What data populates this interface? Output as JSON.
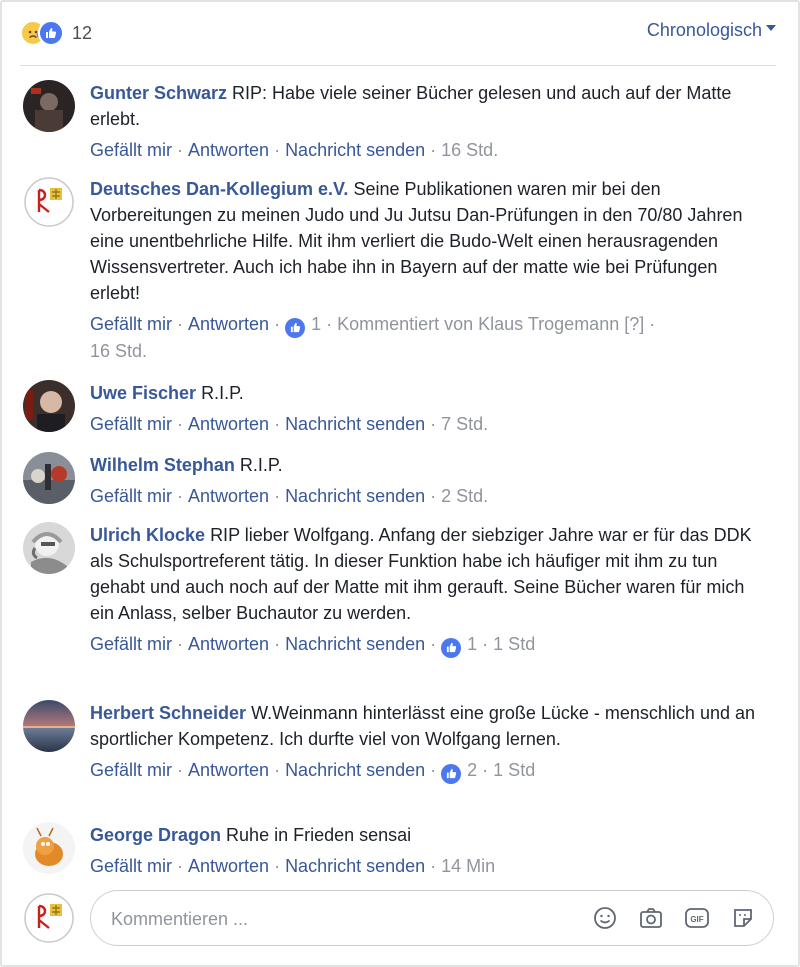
{
  "header": {
    "reaction_count": "12",
    "sort_label": "Chronologisch"
  },
  "comments": [
    {
      "author": "Gunter Schwarz",
      "text": "RIP: Habe viele seiner Bücher gelesen und auch auf der Matte erlebt.",
      "like": "Gefällt mir",
      "reply": "Antworten",
      "message": "Nachricht senden",
      "time": "16 Std."
    },
    {
      "author": "Deutsches Dan-Kollegium e.V.",
      "text": "Seine Publikationen waren mir bei den Vorbereitungen zu meinen Judo und Ju Jutsu Dan-Prüfungen in den 70/80 Jahren eine unentbehrliche Hilfe. Mit ihm verliert die Budo-Welt einen herausragenden Wissensvertreter. Auch ich habe ihn in Bayern auf der matte wie bei Prüfungen erlebt!",
      "like": "Gefällt mir",
      "reply": "Antworten",
      "likes": "1",
      "commented_by": "Kommentiert von Klaus Trogemann [?]",
      "time": "16 Std."
    },
    {
      "author": "Uwe Fischer",
      "text": "R.I.P.",
      "like": "Gefällt mir",
      "reply": "Antworten",
      "message": "Nachricht senden",
      "time": "7 Std."
    },
    {
      "author": "Wilhelm Stephan",
      "text": "R.I.P.",
      "like": "Gefällt mir",
      "reply": "Antworten",
      "message": "Nachricht senden",
      "time": "2 Std."
    },
    {
      "author": "Ulrich Klocke",
      "text": "RIP lieber Wolfgang. Anfang der siebziger Jahre war er für das DDK als Schulsportreferent tätig. In dieser Funktion habe ich häufiger mit ihm zu tun gehabt und auch noch auf der Matte mit ihm gerauft. Seine Bücher waren für mich ein Anlass, selber Buchautor zu werden.",
      "like": "Gefällt mir",
      "reply": "Antworten",
      "message": "Nachricht senden",
      "likes": "1",
      "time": "1 Std"
    },
    {
      "author": "Herbert Schneider",
      "text": "W.Weinmann hinterlässt eine große Lücke - menschlich und an sportlicher Kompetenz. Ich durfte viel von Wolfgang lernen.",
      "like": "Gefällt mir",
      "reply": "Antworten",
      "message": "Nachricht senden",
      "likes": "2",
      "time": "1 Std"
    },
    {
      "author": "George Dragon",
      "text": "Ruhe in Frieden sensai",
      "like": "Gefällt mir",
      "reply": "Antworten",
      "message": "Nachricht senden",
      "time": "14 Min"
    }
  ],
  "composer": {
    "placeholder": "Kommentieren ...",
    "icons": [
      "emoji-icon",
      "camera-icon",
      "gif-icon",
      "sticker-icon"
    ]
  },
  "colors": {
    "link": "#385898",
    "meta": "#90949c",
    "text": "#1d2129",
    "like_blue": "#4c78ef"
  }
}
